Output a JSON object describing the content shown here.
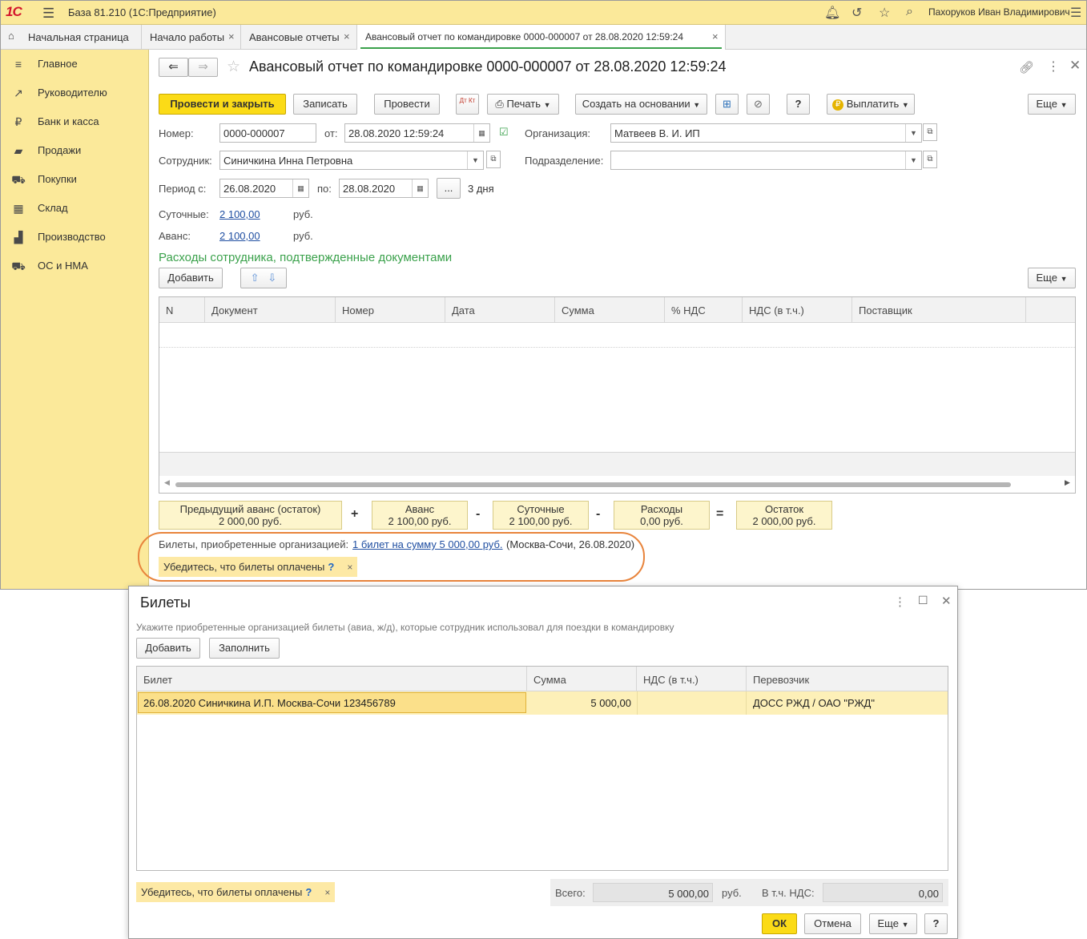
{
  "titlebar": {
    "logo": "1С",
    "title": "База 81.210  (1С:Предприятие)",
    "user": "Пахоруков Иван Владимирович"
  },
  "tabs": [
    {
      "label": "Начальная страница"
    },
    {
      "label": "Начало работы"
    },
    {
      "label": "Авансовые отчеты"
    },
    {
      "label": "Авансовый отчет по командировке 0000-000007 от 28.08.2020 12:59:24"
    }
  ],
  "sidebar": {
    "items": [
      {
        "label": "Главное",
        "icon": "≡"
      },
      {
        "label": "Руководителю",
        "icon": "↗"
      },
      {
        "label": "Банк и касса",
        "icon": "₽"
      },
      {
        "label": "Продажи",
        "icon": "▰"
      },
      {
        "label": "Покупки",
        "icon": "⛟"
      },
      {
        "label": "Склад",
        "icon": "▦"
      },
      {
        "label": "Производство",
        "icon": "▟"
      },
      {
        "label": "ОС и НМА",
        "icon": "⛟"
      }
    ]
  },
  "document": {
    "title": "Авансовый отчет по командировке 0000-000007 от 28.08.2020 12:59:24",
    "toolbar": {
      "post_close": "Провести и закрыть",
      "save": "Записать",
      "post": "Провести",
      "dtkt": "Дт Кт",
      "print": "Печать",
      "create_based": "Создать на основании",
      "help": "?",
      "pay": "Выплатить",
      "more": "Еще"
    },
    "fields": {
      "number_label": "Номер:",
      "number_value": "0000-000007",
      "date_label": "от:",
      "date_value": "28.08.2020 12:59:24",
      "org_label": "Организация:",
      "org_value": "Матвеев В. И. ИП",
      "employee_label": "Сотрудник:",
      "employee_value": "Синичкина Инна Петровна",
      "dept_label": "Подразделение:",
      "dept_value": "",
      "period_from_label": "Период с:",
      "period_from_value": "26.08.2020",
      "period_to_label": "по:",
      "period_to_value": "28.08.2020",
      "period_more": "...",
      "period_days": "3 дня",
      "per_diem_label": "Суточные:",
      "per_diem_value": "2 100,00",
      "per_diem_currency": "руб.",
      "advance_label": "Аванс:",
      "advance_value": "2 100,00",
      "advance_currency": "руб."
    },
    "expenses": {
      "section_title": "Расходы сотрудника, подтвержденные документами",
      "add": "Добавить",
      "more": "Еще",
      "columns": [
        "N",
        "Документ",
        "Номер",
        "Дата",
        "Сумма",
        "% НДС",
        "НДС (в т.ч.)",
        "Поставщик"
      ]
    },
    "summary": {
      "prev_advance_label": "Предыдущий аванс (остаток)",
      "prev_advance_value": "2 000,00 руб.",
      "plus": "+",
      "advance_label": "Аванс",
      "advance_value": "2 100,00 руб.",
      "minus1": "-",
      "per_diem_label": "Суточные",
      "per_diem_value": "2 100,00 руб.",
      "minus2": "-",
      "expenses_label": "Расходы",
      "expenses_value": "0,00 руб.",
      "equals": "=",
      "balance_label": "Остаток",
      "balance_value": "2 000,00 руб."
    },
    "tickets": {
      "label": "Билеты, приобретенные организацией:",
      "link": "1 билет на сумму 5 000,00 руб.",
      "info": "(Москва-Сочи, 26.08.2020)",
      "warning": "Убедитесь, что билеты оплачены",
      "warning_q": "?",
      "warning_close": "×"
    }
  },
  "dialog": {
    "title": "Билеты",
    "hint": "Укажите приобретенные организацией билеты (авиа, ж/д), которые сотрудник использовал для поездки в командировку",
    "add": "Добавить",
    "fill": "Заполнить",
    "columns": [
      "Билет",
      "Сумма",
      "НДС (в т.ч.)",
      "Перевозчик"
    ],
    "rows": [
      {
        "ticket": "26.08.2020 Синичкина И.П. Москва-Сочи 123456789",
        "sum": "5 000,00",
        "vat": "",
        "carrier": "ДОСС РЖД / ОАО \"РЖД\""
      }
    ],
    "warning": "Убедитесь, что билеты оплачены",
    "warning_q": "?",
    "warning_close": "×",
    "total_label": "Всего:",
    "total_value": "5 000,00",
    "total_currency": "руб.",
    "vat_label": "В т.ч. НДС:",
    "vat_value": "0,00",
    "ok": "ОК",
    "cancel": "Отмена",
    "more": "Еще",
    "help": "?"
  },
  "colors": {
    "accent_yellow": "#fbe99a",
    "primary_button": "#fbdb17",
    "section_green": "#3aa14b",
    "link_blue": "#1f4ea1",
    "highlight_orange": "#e8843c"
  }
}
